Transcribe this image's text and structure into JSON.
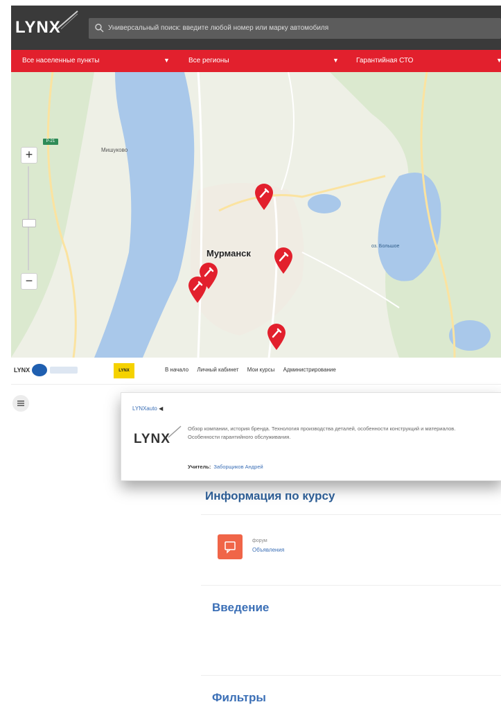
{
  "header": {
    "logo": "LYNX",
    "logo_tagline": "",
    "search_placeholder": "Универсальный поиск: введите любой номер или марку автомобиля"
  },
  "filters": {
    "items": [
      {
        "label": "Все населенные пункты"
      },
      {
        "label": "Все регионы"
      },
      {
        "label": "Гарантийная СТО"
      }
    ]
  },
  "map": {
    "city_label": "Мурманск",
    "place_label": "Мишуково",
    "lake_label": "оз. Большое",
    "road_badge": "Р-21",
    "zoom_in": "+",
    "zoom_out": "−",
    "marker_icon": "wrench-pin-icon",
    "marker_color": "#e2202d"
  },
  "partners": {
    "brands": [
      "LYNX",
      "",
      "",
      "",
      "LYNX"
    ],
    "nav": [
      "В начало",
      "Личный кабинет",
      "Мои курсы",
      "Администрирование"
    ]
  },
  "popup": {
    "header": "LYNXauto",
    "logo": "LYNX",
    "description": "Обзор компании, история бренда. Технология производства деталей, особенности конструкций и материалов. Особенности гарантийного обслуживания.",
    "teacher_label": "Учитель:",
    "teacher_name": "Заборщиков Андрей"
  },
  "content": {
    "info_title": "Информация по курсу",
    "forum_meta": "форум",
    "forum_link": "Объявления",
    "intro_title": "Введение",
    "filters_title": "Фильтры"
  },
  "colors": {
    "brand_red": "#e2202d",
    "header_dark": "#3a3a3a",
    "link_blue": "#3b6fb6",
    "forum_orange": "#f06548"
  }
}
